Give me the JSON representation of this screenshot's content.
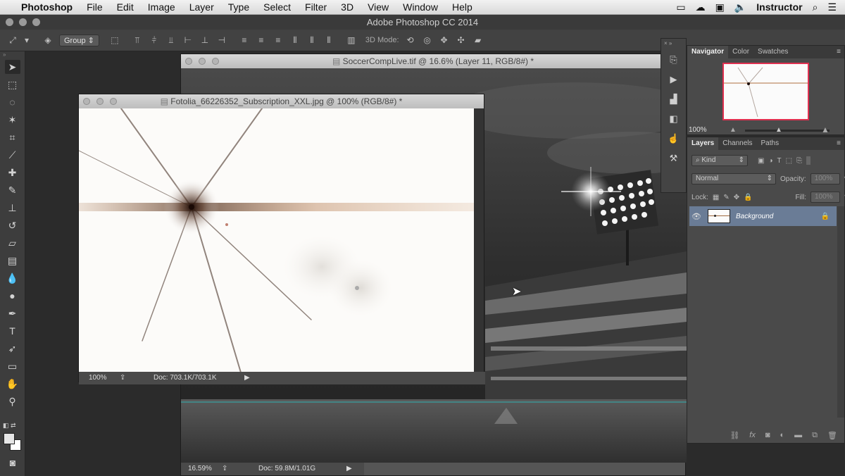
{
  "menubar": {
    "apple_icon": "apple-icon",
    "app_name": "Photoshop",
    "items": [
      "File",
      "Edit",
      "Image",
      "Layer",
      "Type",
      "Select",
      "Filter",
      "3D",
      "View",
      "Window",
      "Help"
    ],
    "user": "Instructor"
  },
  "window_title": "Adobe Photoshop CC 2014",
  "options_bar": {
    "group_select": "Group",
    "mode_label": "3D Mode:"
  },
  "doc_back": {
    "title": "SoccerCompLive.tif @ 16.6% (Layer 11, RGB/8#) *",
    "zoom": "16.59%",
    "doc_info": "Doc: 59.8M/1.01G"
  },
  "doc_front": {
    "title": "Fotolia_66226352_Subscription_XXL.jpg @ 100% (RGB/8#) *",
    "zoom": "100%",
    "doc_info": "Doc: 703.1K/703.1K"
  },
  "nav_panel": {
    "tabs": [
      "Navigator",
      "Color",
      "Swatches"
    ],
    "zoom": "100%"
  },
  "layers_panel": {
    "tabs": [
      "Layers",
      "Channels",
      "Paths"
    ],
    "filter": "Kind",
    "blend_mode": "Normal",
    "opacity_label": "Opacity:",
    "opacity_value": "100%",
    "lock_label": "Lock:",
    "fill_label": "Fill:",
    "fill_value": "100%",
    "layer_name": "Background"
  },
  "colors": {
    "accent": "#6a7c96",
    "nav_box": "#e03050",
    "guide": "#2fb0b0"
  }
}
